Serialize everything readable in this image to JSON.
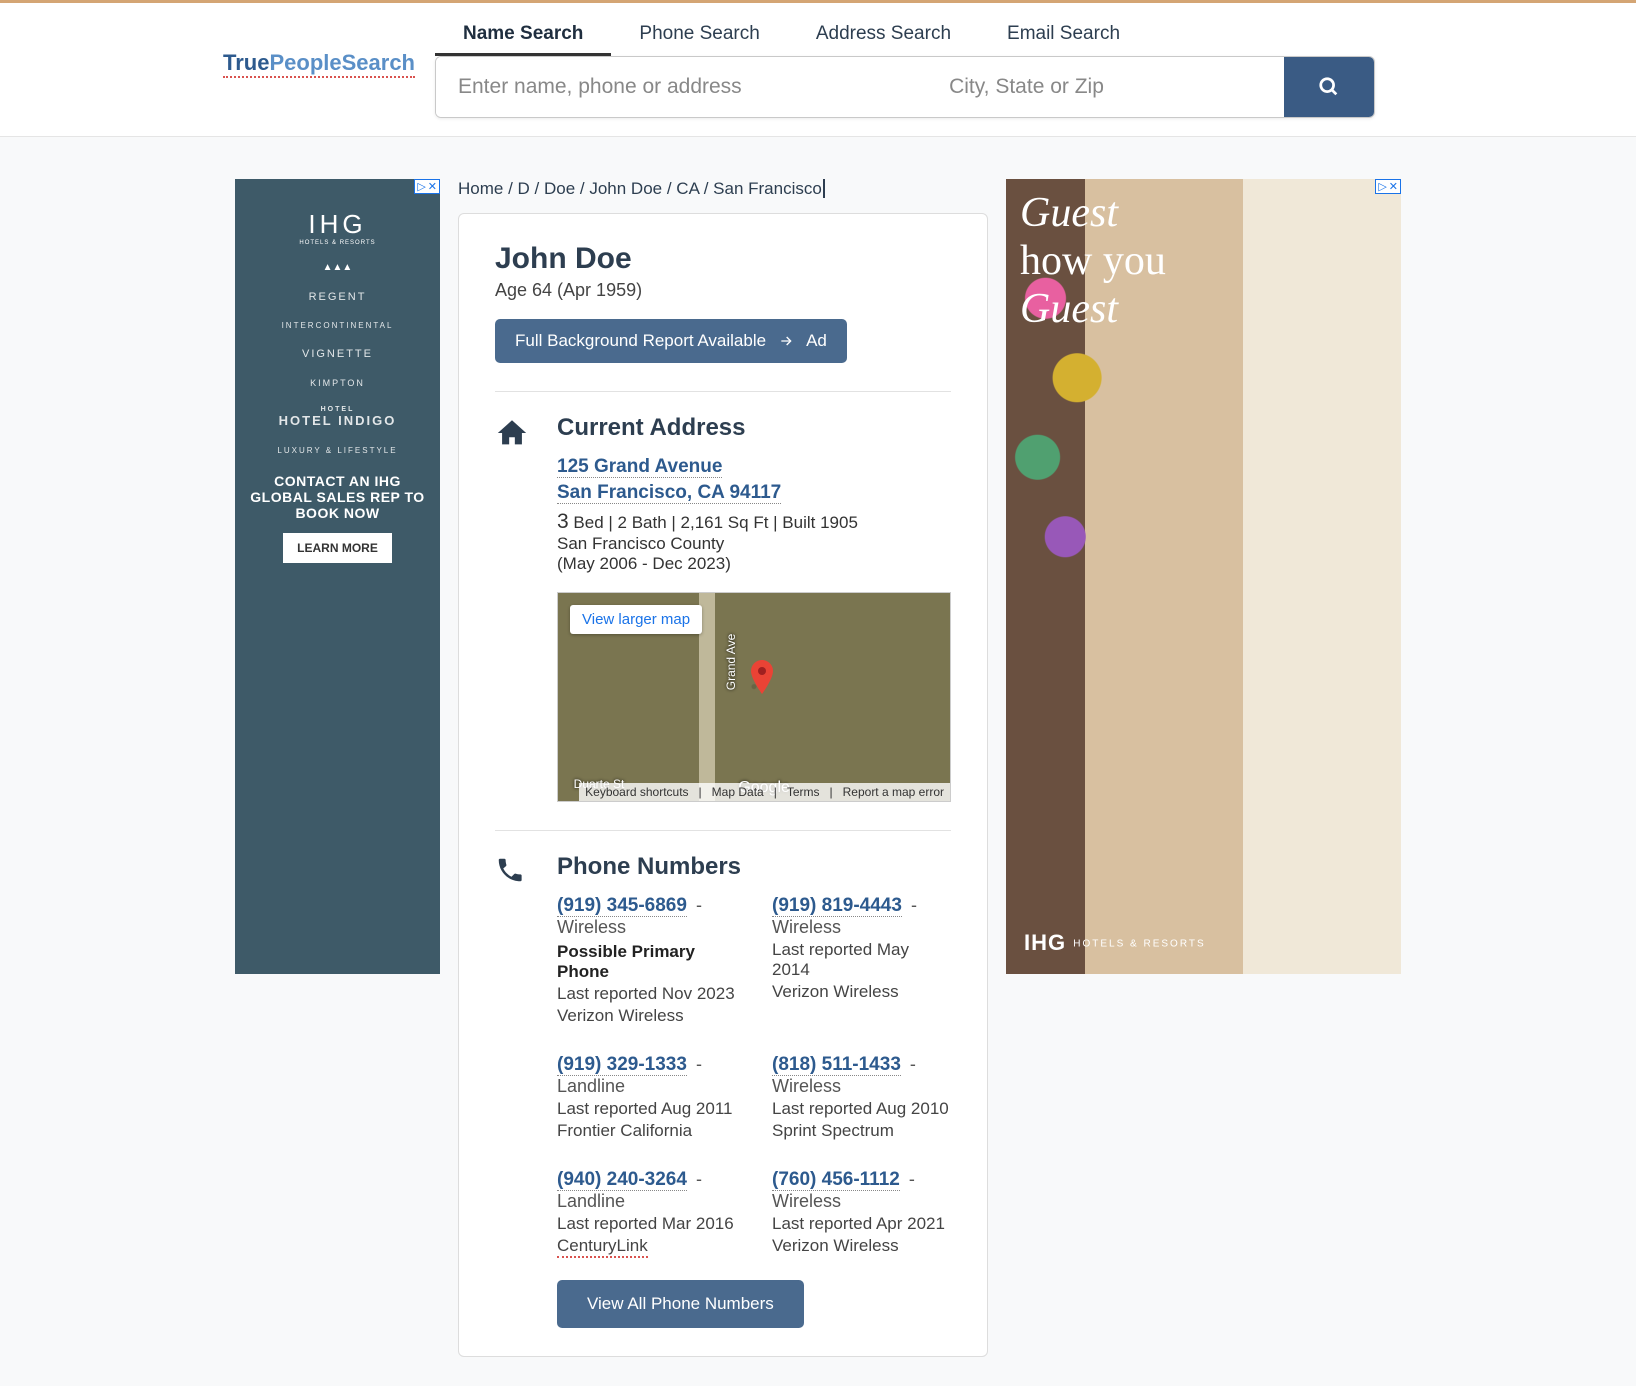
{
  "logo": {
    "part1": "True",
    "part2": "People",
    "part3": "Search"
  },
  "tabs": {
    "name": "Name Search",
    "phone": "Phone Search",
    "address": "Address Search",
    "email": "Email Search",
    "active": "name"
  },
  "search": {
    "placeholder_main": "Enter name, phone or address",
    "placeholder_location": "City, State or Zip"
  },
  "breadcrumb": {
    "home": "Home",
    "letter": "D",
    "surname": "Doe",
    "fullname": "John Doe",
    "state": "CA",
    "city": "San Francisco"
  },
  "person": {
    "name": "John Doe",
    "age_line": "Age 64 (Apr 1959)",
    "bg_report_label": "Full Background Report Available",
    "bg_report_ad": "Ad"
  },
  "address_section": {
    "title": "Current Address",
    "street": "125 Grand Avenue",
    "citystate": "San Francisco, CA 94117",
    "facts_bed": "3",
    "facts_rest": " Bed | 2 Bath | 2,161 Sq Ft | Built 1905",
    "county": "San Francisco County",
    "dates": "(May 2006 - Dec 2023)",
    "map": {
      "view_larger": "View larger map",
      "road1": "Grand Ave",
      "road2": "Duarte St",
      "brand": "Google",
      "footer_shortcuts": "Keyboard shortcuts",
      "footer_mapdata": "Map Data",
      "footer_terms": "Terms",
      "footer_report": "Report a map error"
    }
  },
  "phones_section": {
    "title": "Phone Numbers",
    "items": [
      {
        "number": "(919) 345-6869",
        "type": "Wireless",
        "primary": "Possible Primary Phone",
        "reported": "Last reported Nov 2023",
        "carrier": "Verizon Wireless"
      },
      {
        "number": "(919) 819-4443",
        "type": "Wireless",
        "primary": "",
        "reported": "Last reported May 2014",
        "carrier": "Verizon Wireless"
      },
      {
        "number": "(919) 329-1333",
        "type": "Landline",
        "primary": "",
        "reported": "Last reported Aug 2011",
        "carrier": "Frontier California"
      },
      {
        "number": "(818) 511-1433",
        "type": "Wireless",
        "primary": "",
        "reported": "Last reported Aug 2010",
        "carrier": "Sprint Spectrum"
      },
      {
        "number": "(940) 240-3264",
        "type": "Landline",
        "primary": "",
        "reported": "Last reported Mar 2016",
        "carrier": "CenturyLink",
        "carrier_squiggle": true
      },
      {
        "number": "(760) 456-1112",
        "type": "Wireless",
        "primary": "",
        "reported": "Last reported Apr 2021",
        "carrier": "Verizon Wireless"
      }
    ],
    "view_all": "View All Phone Numbers"
  },
  "ads": {
    "left": {
      "brand": "IHG",
      "brand_sub": "HOTELS & RESORTS",
      "items": [
        "REGENT",
        "INTERCONTINENTAL",
        "VIGNETTE",
        "KIMPTON",
        "HOTEL INDIGO",
        "LUXURY & LIFESTYLE"
      ],
      "cta_text": "CONTACT AN IHG GLOBAL SALES REP TO BOOK NOW",
      "learn": "LEARN MORE"
    },
    "right": {
      "line1": "Guest",
      "line2": "how you",
      "line3": "Guest",
      "brand": "IHG",
      "brand_sub": "HOTELS & RESORTS"
    }
  }
}
